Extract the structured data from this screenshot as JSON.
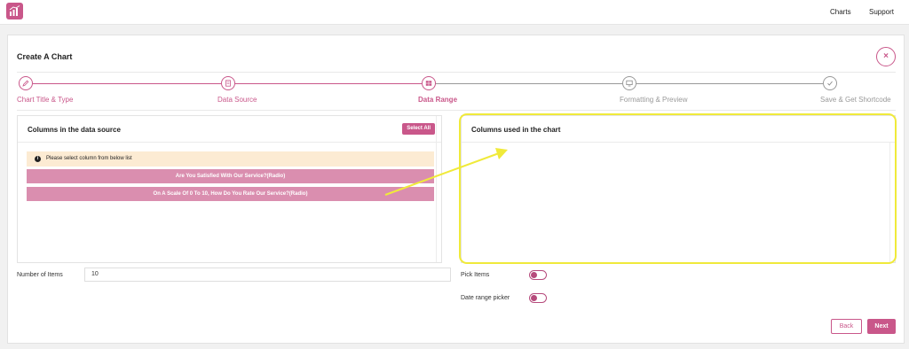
{
  "nav": {
    "charts": "Charts",
    "support": "Support"
  },
  "page": {
    "title": "Create A Chart",
    "close_symbol": "×"
  },
  "steps": [
    {
      "label": "Chart Title & Type",
      "icon": "pencil-icon",
      "state": "done"
    },
    {
      "label": "Data Source",
      "icon": "document-icon",
      "state": "done"
    },
    {
      "label": "Data Range",
      "icon": "table-icon",
      "state": "active"
    },
    {
      "label": "Formatting & Preview",
      "icon": "monitor-icon",
      "state": "todo"
    },
    {
      "label": "Save & Get Shortcode",
      "icon": "check-icon",
      "state": "todo"
    }
  ],
  "source_box": {
    "title": "Columns in the data source",
    "select_all": "Select All",
    "notice": "Please select column from below list",
    "columns": [
      "Are You Satisfied With Our Service?(Radio)",
      "On A Scale Of 0 To 10, How Do You Rate Our Service?(Radio)"
    ]
  },
  "chart_box": {
    "title": "Columns used in the chart"
  },
  "form": {
    "items_label": "Number of Items",
    "items_value": "10",
    "pick_items_label": "Pick Items",
    "date_range_label": "Date range picker"
  },
  "buttons": {
    "back": "Back",
    "next": "Next"
  },
  "colors": {
    "accent": "#c9578a",
    "column_item": "#da8eaf",
    "notice_bg": "#fcebd3",
    "highlight": "#f0ea3a"
  }
}
